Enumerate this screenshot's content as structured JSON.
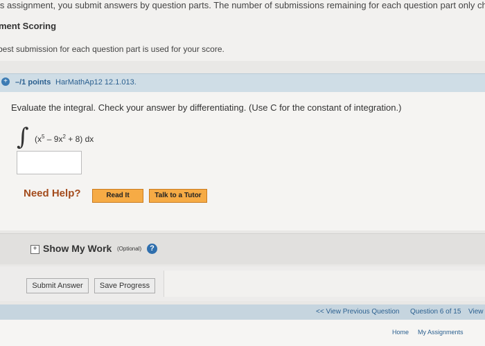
{
  "intro": {
    "assignment_text": "is assignment, you submit answers by question parts. The number of submissions remaining for each question part only change",
    "scoring_title": "ment Scoring",
    "best_submission_text": "best submission for each question part is used for your score."
  },
  "question": {
    "points": "–/1 points",
    "id": "HarMathAp12 12.1.013.",
    "prompt": "Evaluate the integral. Check your answer by differentiating. (Use C for the constant of integration.)",
    "integrand": {
      "open": "(x",
      "exp1": "5",
      "middle": " – 9x",
      "exp2": "2",
      "tail": " + 8) dx"
    }
  },
  "help": {
    "label": "Need Help?",
    "read_it": "Read It",
    "talk_to_tutor": "Talk to a Tutor"
  },
  "work": {
    "title": "Show My Work",
    "optional": "(Optional)"
  },
  "actions": {
    "submit": "Submit Answer",
    "save": "Save Progress"
  },
  "navigation": {
    "previous": "<< View Previous Question",
    "position": "Question 6 of 15",
    "next_partial": "View"
  },
  "footer": {
    "home": "Home",
    "assignments": "My Assignments"
  },
  "colors": {
    "header_blue": "#cfdde6",
    "help_orange": "#f6ab45",
    "link_blue": "#2a5f8f"
  },
  "icons": {
    "points": "plus-circle-icon",
    "expand": "plus-box-icon",
    "help": "question-circle-icon"
  }
}
